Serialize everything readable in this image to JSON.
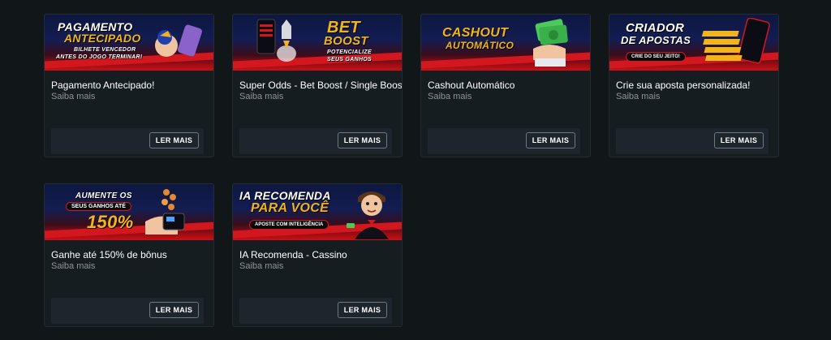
{
  "cards": [
    {
      "banner": {
        "line1": "PAGAMENTO",
        "line2": "ANTECIPADO",
        "line3": "BILHETE VENCEDOR",
        "line4": "ANTES DO JOGO TERMINAR!"
      },
      "title": "Pagamento Antecipado!",
      "subtitle": "Saiba mais",
      "button": "LER MAIS"
    },
    {
      "banner": {
        "line1": "BET",
        "line2": "BOOST",
        "line3": "POTENCIALIZE",
        "line4": "SEUS GANHOS"
      },
      "title": "Super Odds - Bet Boost / Single Boost",
      "subtitle": "Saiba mais",
      "button": "LER MAIS"
    },
    {
      "banner": {
        "line1": "CASHOUT",
        "line2": "AUTOMÁTICO"
      },
      "title": "Cashout Automático",
      "subtitle": "Saiba mais",
      "button": "LER MAIS"
    },
    {
      "banner": {
        "line1": "CRIADOR",
        "line2": "DE APOSTAS",
        "line3": "CRIE DO SEU JEITO!"
      },
      "title": "Crie sua aposta personalizada!",
      "subtitle": "Saiba mais",
      "button": "LER MAIS"
    },
    {
      "banner": {
        "line1": "AUMENTE OS",
        "line2": "SEUS GANHOS ATÉ",
        "line3": "150%"
      },
      "title": "Ganhe até 150% de bônus",
      "subtitle": "Saiba mais",
      "button": "LER MAIS"
    },
    {
      "banner": {
        "line1": "IA RECOMENDA",
        "line2": "PARA VOCÊ",
        "line3": "APOSTE COM INTELIGÊNCIA"
      },
      "title": "IA Recomenda - Cassino",
      "subtitle": "Saiba mais",
      "button": "LER MAIS"
    }
  ],
  "colors": {
    "background": "#111719",
    "card": "#151d21",
    "accent_red": "#d3171f",
    "gold": "#f3b41b"
  }
}
